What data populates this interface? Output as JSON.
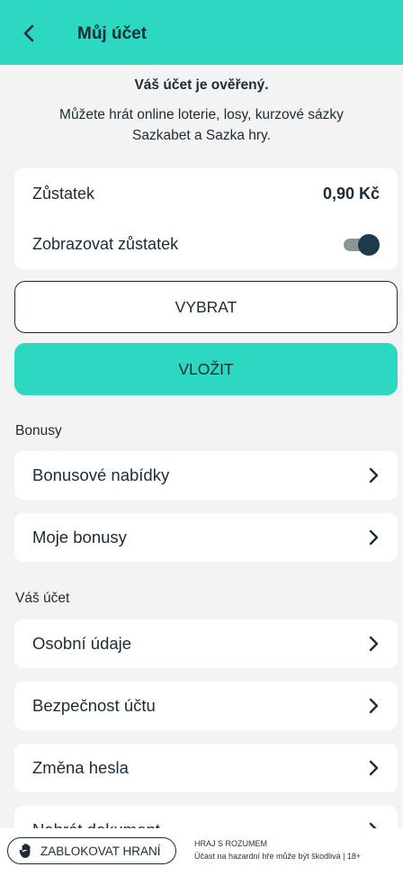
{
  "header": {
    "title": "Můj účet"
  },
  "verification": {
    "title": "Váš účet je ověřený.",
    "line1": "Můžete hrát online loterie, losy, kurzové sázky",
    "line2": "Sazkabet a Sazka hry."
  },
  "balance": {
    "label": "Zůstatek",
    "value": "0,90 Kč",
    "show_label": "Zobrazovat zůstatek",
    "show_enabled": true
  },
  "actions": {
    "withdraw": "VYBRAT",
    "deposit": "VLOŽIT"
  },
  "bonus_section": {
    "label": "Bonusy",
    "items": [
      {
        "label": "Bonusové nabídky"
      },
      {
        "label": "Moje bonusy"
      }
    ]
  },
  "account_section": {
    "label": "Váš účet",
    "items": [
      {
        "label": "Osobní údaje"
      },
      {
        "label": "Bezpečnost účtu"
      },
      {
        "label": "Změna hesla"
      },
      {
        "label": "Nahrát dokument"
      }
    ]
  },
  "footer": {
    "block_label": "ZABLOKOVAT HRANÍ",
    "responsible_title": "HRAJ S ROZUMEM",
    "responsible_text": "Účast na hazardní hře může být škodlivá | 18+"
  },
  "colors": {
    "accent": "#2dd8c0",
    "text": "#1d2b36",
    "background": "#f3f3f3"
  }
}
